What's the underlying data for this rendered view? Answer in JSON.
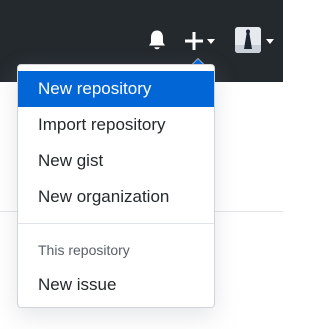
{
  "header": {
    "background_color": "#24292e",
    "notifications_icon": "bell-icon",
    "create_icon": "plus-icon",
    "profile_icon": "avatar"
  },
  "menu": {
    "highlight_color": "#0366d6",
    "items": [
      {
        "label": "New repository",
        "active": true
      },
      {
        "label": "Import repository",
        "active": false
      },
      {
        "label": "New gist",
        "active": false
      },
      {
        "label": "New organization",
        "active": false
      }
    ],
    "section_header": "This repository",
    "section_items": [
      {
        "label": "New issue",
        "active": false
      }
    ]
  }
}
